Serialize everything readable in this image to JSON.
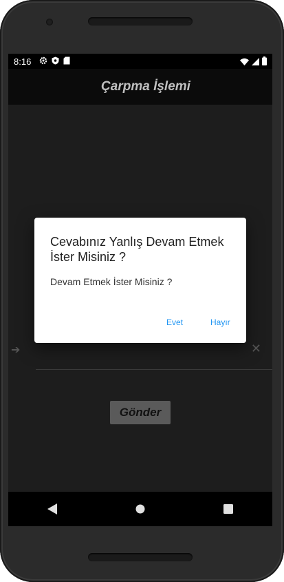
{
  "status": {
    "time": "8:16"
  },
  "app": {
    "title": "Çarpma İşlemi"
  },
  "main": {
    "submit_label": "Gönder"
  },
  "dialog": {
    "title": "Cevabınız Yanlış Devam Etmek İster Misiniz ?",
    "message": "Devam Etmek İster Misiniz ?",
    "positive_label": "Evet",
    "negative_label": "Hayır",
    "accent_color": "#2196f3"
  },
  "icons": {
    "status": [
      "gear-icon",
      "shield-icon",
      "sd-card-icon",
      "wifi-icon",
      "signal-icon",
      "battery-icon"
    ],
    "nav": [
      "back-icon",
      "home-icon",
      "recents-icon"
    ]
  }
}
